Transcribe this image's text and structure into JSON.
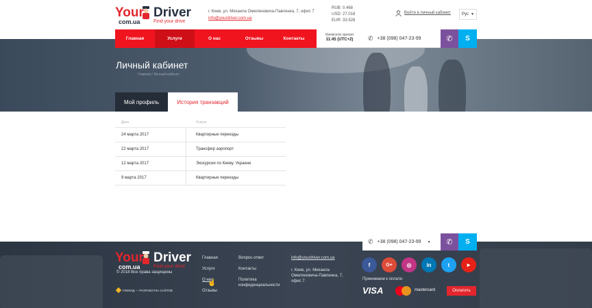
{
  "header": {
    "logo": {
      "your": "Your",
      "driver": "Driver",
      "domain": "com.ua",
      "tagline": "Find your drive"
    },
    "address": "г. Киев, ул. Михаила Омеляновича-Павленка, 7, офис 7",
    "email": "info@yourdriver.com.ua",
    "rates": [
      "RUB: 0.468",
      "USD: 27.018",
      "EUR: 33.528"
    ],
    "login": "Войти в личный кабинет",
    "lang": "Рус"
  },
  "nav": {
    "items": [
      "Главная",
      "Услуги",
      "О нас",
      "Отзывы",
      "Контакты"
    ],
    "time_label": "Киевское время",
    "time_value": "11:45 (UTC+2)",
    "phone": "+38 (098) 047-23-99"
  },
  "hero": {
    "title": "Личный кабинет",
    "breadcrumb": "Главная / Личный кабинет"
  },
  "tabs": [
    "Мой профиль",
    "История транзакций"
  ],
  "table": {
    "headers": [
      "Дата",
      "Услуга"
    ],
    "rows": [
      {
        "date": "24 марта 2017",
        "service": "Квартирные переезды"
      },
      {
        "date": "22 марта 2017",
        "service": "Трансфер аэропорт"
      },
      {
        "date": "12 марта 2017",
        "service": "Экскурсии по Киеву. Украине"
      },
      {
        "date": "9 марта 2017",
        "service": "Квартирные переезды"
      }
    ]
  },
  "footer": {
    "phone": "+38 (098) 047-23-99",
    "copyright": "© 2018 Все права защищены",
    "dev_credit": "ГЛИКОД — РАЗРАБОТКА САЙТОВ",
    "col1": [
      "Главная",
      "Услуги",
      "О нас",
      "Отзывы"
    ],
    "col2": [
      "Вопрос-ответ",
      "Контакты",
      "Политика конфиденциальности"
    ],
    "email": "info@yourdriver.com.ua",
    "address": "г. Киев, ул. Михаила Омеляновича-Павленка, 7, офис 7.",
    "payment_label": "Принимаем к оплате:",
    "visa": "VISA",
    "mastercard": "mastercard",
    "pay_button": "Оплатить",
    "social": [
      "f",
      "G+",
      "◎",
      "in",
      "t",
      "▶"
    ]
  },
  "colors": {
    "brand_red": "#e3262d",
    "nav_red": "#f0141f",
    "viber": "#7b519d",
    "skype": "#00aff0",
    "dark": "#263040"
  }
}
